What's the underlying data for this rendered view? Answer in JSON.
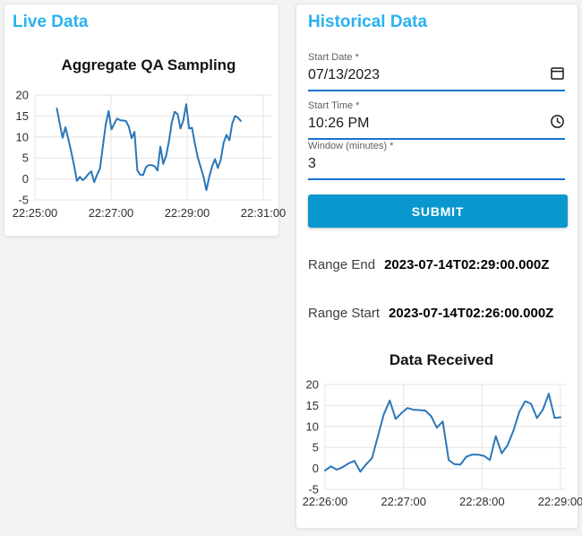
{
  "page": {
    "accent_color": "#29b2ef",
    "submit_color": "#0a97cf",
    "underline_color": "#1773cf"
  },
  "live_panel": {
    "title": "Live Data"
  },
  "historical_panel": {
    "title": "Historical Data",
    "fields": [
      {
        "label": "Start Date *",
        "value": "07/13/2023",
        "icon": "calendar-icon"
      },
      {
        "label": "Start Time *",
        "value": "10:26 PM",
        "icon": "clock-icon"
      },
      {
        "label": "Window (minutes) *",
        "value": "3",
        "icon": ""
      }
    ],
    "submit_label": "SUBMIT",
    "range_end": {
      "label": "Range End",
      "value": "2023-07-14T02:29:00.000Z"
    },
    "range_start": {
      "label": "Range Start",
      "value": "2023-07-14T02:26:00.000Z"
    }
  },
  "chart_data": [
    {
      "type": "line",
      "title": "Aggregate QA Sampling",
      "xlabel": "",
      "ylabel": "",
      "x_ticks": [
        "22:25:00",
        "22:27:00",
        "22:29:00",
        "22:31:00"
      ],
      "y_ticks": [
        20,
        15,
        10,
        5,
        0,
        -5
      ],
      "ylim": [
        -5,
        20
      ],
      "grid": true,
      "legend": "none",
      "line_color": "#2b77b8",
      "x_domain_frac": [
        0.096,
        0.902
      ],
      "values": [
        16.8,
        13.2,
        9.8,
        12.3,
        9.5,
        6.5,
        3.2,
        -0.5,
        0.5,
        -0.3,
        0.3,
        1.2,
        1.8,
        -0.8,
        1.0,
        2.5,
        7.8,
        13.0,
        16.2,
        11.8,
        13.2,
        14.4,
        14.0,
        13.9,
        13.8,
        12.5,
        9.7,
        11.2,
        2.0,
        1.0,
        0.9,
        2.8,
        3.3,
        3.3,
        3.0,
        2.0,
        7.7,
        3.6,
        5.5,
        9.0,
        13.5,
        16.0,
        15.4,
        12.0,
        14.0,
        17.8,
        12.0,
        12.2,
        8.5,
        5.2,
        2.8,
        0.5,
        -2.7,
        0.5,
        3.0,
        4.7,
        2.6,
        4.5,
        8.6,
        10.5,
        9.2,
        13.2,
        15.0,
        14.6,
        13.8
      ]
    },
    {
      "type": "line",
      "title": "Data Received",
      "xlabel": "",
      "ylabel": "",
      "x_ticks": [
        "22:26:00",
        "22:27:00",
        "22:28:00",
        "22:29:00"
      ],
      "y_ticks": [
        20,
        15,
        10,
        5,
        0,
        -5
      ],
      "ylim": [
        -5,
        20
      ],
      "grid": true,
      "legend": "none",
      "line_color": "#2b77b8",
      "x_domain_frac": [
        0,
        1
      ],
      "values": [
        -0.5,
        0.5,
        -0.3,
        0.3,
        1.2,
        1.8,
        -0.8,
        1.0,
        2.5,
        7.8,
        13.0,
        16.2,
        11.8,
        13.2,
        14.4,
        14.0,
        13.9,
        13.8,
        12.5,
        9.7,
        11.2,
        2.0,
        1.0,
        0.9,
        2.8,
        3.3,
        3.3,
        3.0,
        2.0,
        7.7,
        3.6,
        5.5,
        9.0,
        13.5,
        16.0,
        15.4,
        12.0,
        14.0,
        17.8,
        12.0,
        12.2
      ]
    }
  ]
}
